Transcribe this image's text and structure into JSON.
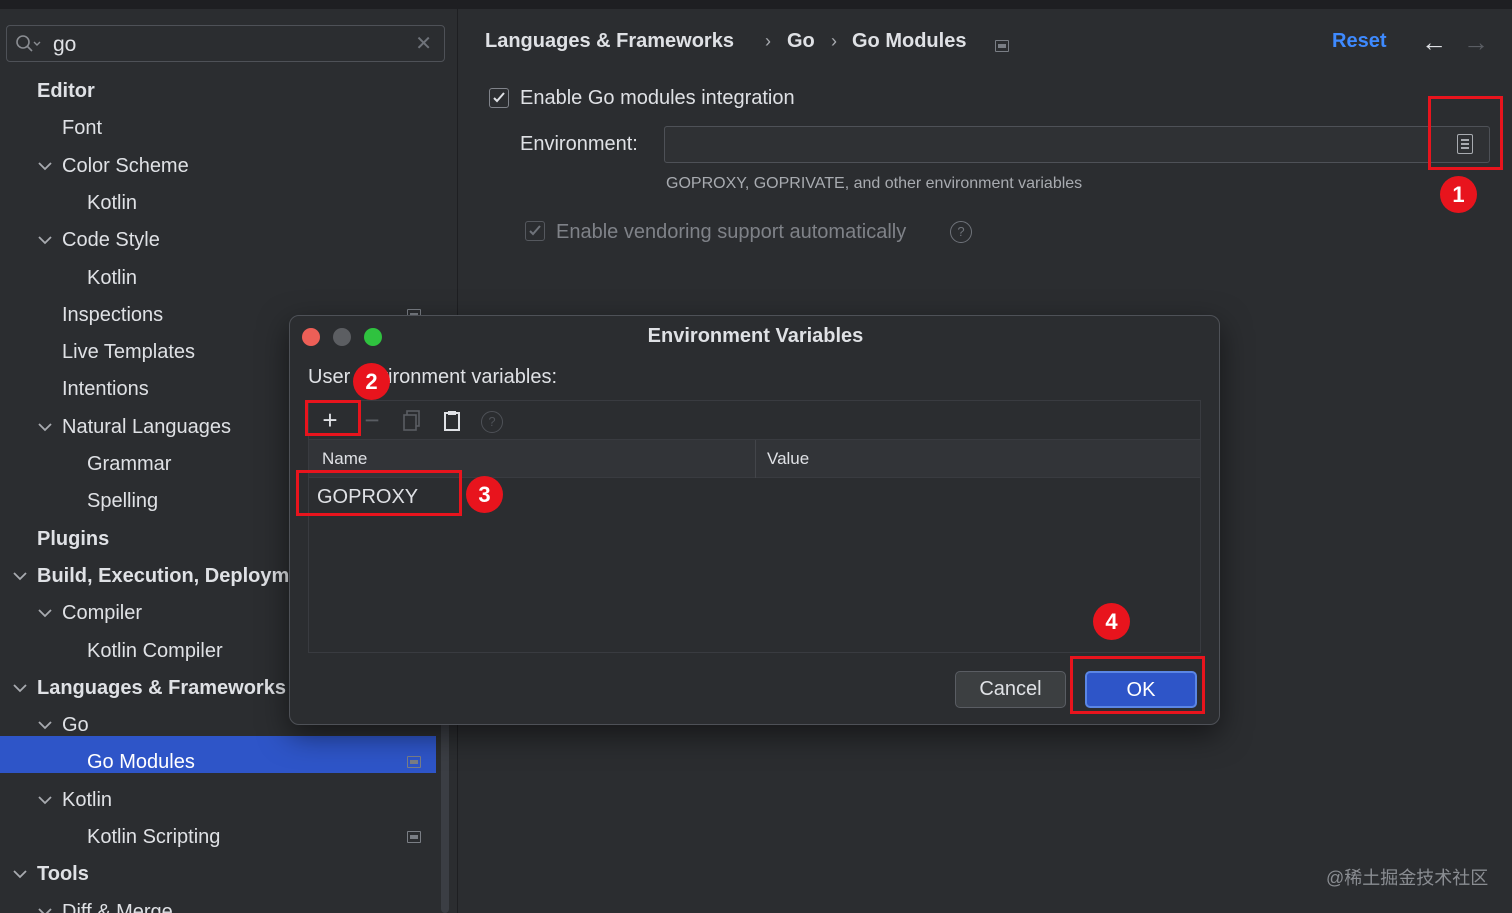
{
  "search": {
    "value": "go"
  },
  "sidebar": {
    "items": [
      {
        "label": "Editor",
        "level": 0,
        "bold": true,
        "expanded": null
      },
      {
        "label": "Font",
        "level": 1,
        "bold": false,
        "expanded": null
      },
      {
        "label": "Color Scheme",
        "level": 1,
        "bold": false,
        "expanded": true
      },
      {
        "label": "Kotlin",
        "level": 2,
        "bold": false,
        "expanded": null
      },
      {
        "label": "Code Style",
        "level": 1,
        "bold": false,
        "expanded": true
      },
      {
        "label": "Kotlin",
        "level": 2,
        "bold": false,
        "expanded": null
      },
      {
        "label": "Inspections",
        "level": 1,
        "bold": false,
        "expanded": null,
        "project_icon": true
      },
      {
        "label": "Live Templates",
        "level": 1,
        "bold": false,
        "expanded": null
      },
      {
        "label": "Intentions",
        "level": 1,
        "bold": false,
        "expanded": null
      },
      {
        "label": "Natural Languages",
        "level": 1,
        "bold": false,
        "expanded": true
      },
      {
        "label": "Grammar",
        "level": 2,
        "bold": false,
        "expanded": null
      },
      {
        "label": "Spelling",
        "level": 2,
        "bold": false,
        "expanded": null
      },
      {
        "label": "Plugins",
        "level": 0,
        "bold": true,
        "expanded": null
      },
      {
        "label": "Build, Execution, Deployment",
        "level": 0,
        "bold": true,
        "expanded": true
      },
      {
        "label": "Compiler",
        "level": 1,
        "bold": false,
        "expanded": true
      },
      {
        "label": "Kotlin Compiler",
        "level": 2,
        "bold": false,
        "expanded": null
      },
      {
        "label": "Languages & Frameworks",
        "level": 0,
        "bold": true,
        "expanded": true
      },
      {
        "label": "Go",
        "level": 1,
        "bold": false,
        "expanded": true
      },
      {
        "label": "Go Modules",
        "level": 2,
        "bold": false,
        "expanded": null,
        "selected": true,
        "project_icon": true
      },
      {
        "label": "Kotlin",
        "level": 1,
        "bold": false,
        "expanded": true
      },
      {
        "label": "Kotlin Scripting",
        "level": 2,
        "bold": false,
        "expanded": null,
        "project_icon": true
      },
      {
        "label": "Tools",
        "level": 0,
        "bold": true,
        "expanded": true
      },
      {
        "label": "Diff & Merge",
        "level": 1,
        "bold": false,
        "expanded": true
      }
    ]
  },
  "breadcrumb": {
    "items": [
      "Languages & Frameworks",
      "Go",
      "Go Modules"
    ],
    "separator": "›"
  },
  "header": {
    "reset_label": "Reset",
    "back_icon": "arrow-left-icon",
    "forward_icon": "arrow-right-icon"
  },
  "go_modules": {
    "enable_integration": {
      "label": "Enable Go modules integration",
      "checked": true
    },
    "environment": {
      "label": "Environment:",
      "value": "",
      "hint": "GOPROXY, GOPRIVATE, and other environment variables"
    },
    "vendoring": {
      "label": "Enable vendoring support automatically",
      "checked": true,
      "disabled": true
    }
  },
  "dialog": {
    "title": "Environment Variables",
    "user_label": "User environment variables:",
    "toolbar": {
      "add": "+",
      "remove": "−"
    },
    "columns": [
      "Name",
      "Value"
    ],
    "rows": [
      {
        "name": "GOPROXY",
        "value": ""
      }
    ],
    "cancel_label": "Cancel",
    "ok_label": "OK"
  },
  "annotations": {
    "badges": [
      "1",
      "2",
      "3",
      "4"
    ],
    "color": "#e8141d"
  },
  "watermark": "@稀土掘金技术社区",
  "colors": {
    "accent": "#2e55c8",
    "link": "#3e8aff",
    "annotation": "#e8141d"
  }
}
